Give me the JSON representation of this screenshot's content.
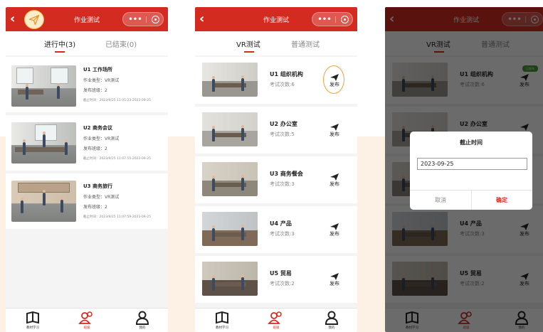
{
  "header": {
    "title": "作业测试"
  },
  "screen1": {
    "tabs": [
      "进行中(3)",
      "已结束(0)"
    ],
    "cards": [
      {
        "title": "U1 工作场所",
        "type": "作业类型：VR测试",
        "classes": "发布班级：2",
        "deadline": "截止时间：2023/9/25 11:05:23-2023-09-25"
      },
      {
        "title": "U2 商务会议",
        "type": "作业类型：VR测试",
        "classes": "发布班级：2",
        "deadline": "截止时间：2023/9/25 11:07:55-2023-09-25"
      },
      {
        "title": "U3 商务旅行",
        "type": "作业类型：VR测试",
        "classes": "发布班级：2",
        "deadline": "截止时间：2023/9/25 11:07:59-2023-09-25"
      }
    ]
  },
  "screen2": {
    "tabs": [
      "VR测试",
      "普通测试"
    ],
    "publish_label": "发布",
    "items": [
      {
        "title": "U1 组织机构",
        "count": "考试次数:6"
      },
      {
        "title": "U2 办公室",
        "count": "考试次数:5"
      },
      {
        "title": "U3 商务餐会",
        "count": "考试次数:3"
      },
      {
        "title": "U4 产品",
        "count": "考试次数:3"
      },
      {
        "title": "U5 贸易",
        "count": "考试次数:2"
      }
    ]
  },
  "screen3": {
    "badge": "已发布",
    "dialog": {
      "title": "截止时间",
      "date_value": "2023-09-25",
      "cancel": "取消",
      "confirm": "确定"
    }
  },
  "nav": {
    "items": [
      "教材学习",
      "班级",
      "我的"
    ]
  },
  "colors": {
    "brand": "#d42b21",
    "highlight": "#f0a03a"
  }
}
